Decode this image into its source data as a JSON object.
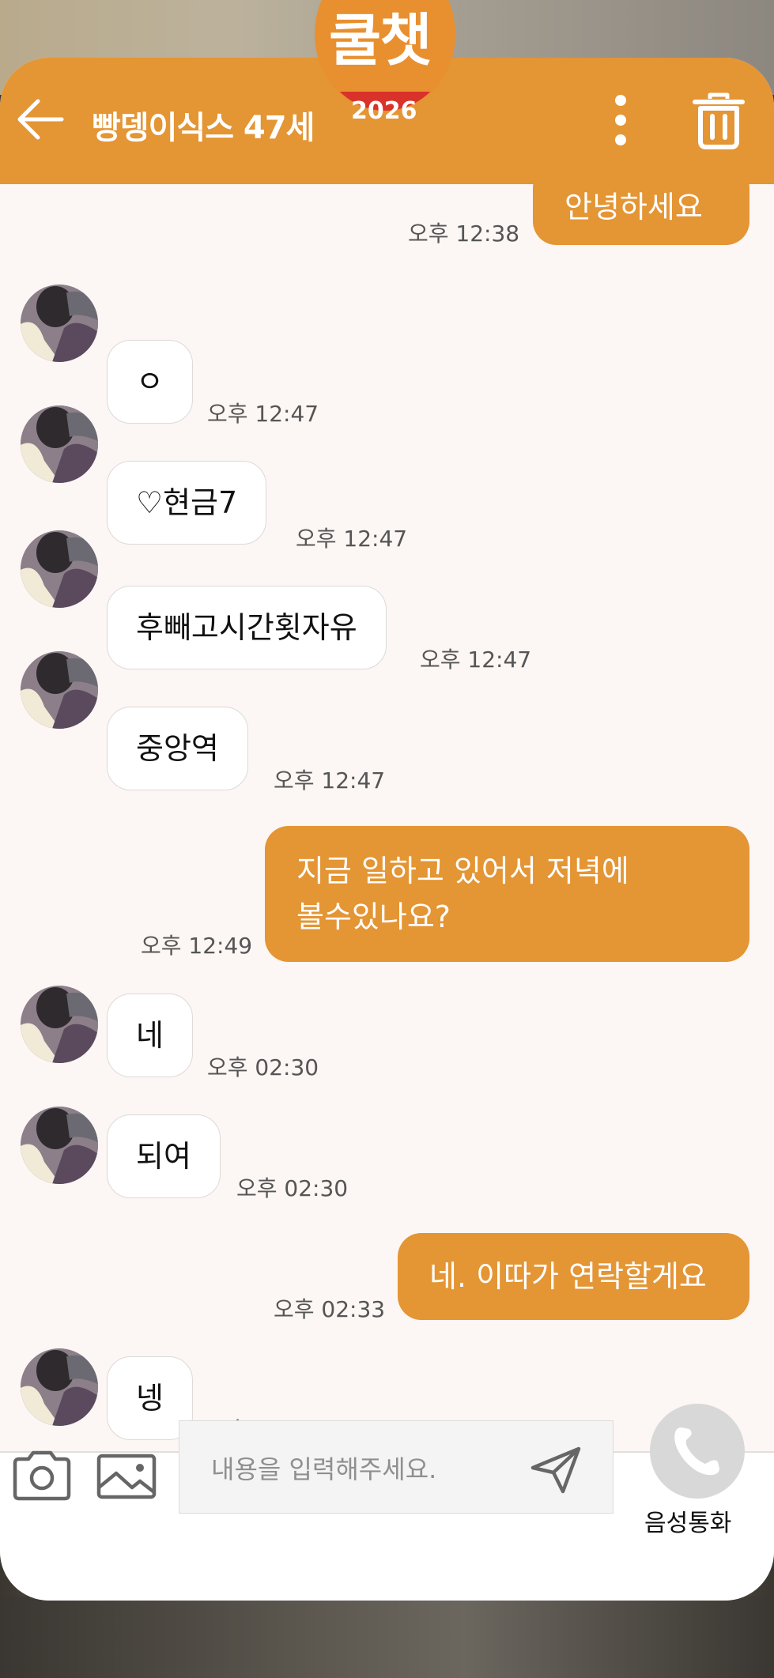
{
  "header": {
    "title": "빵뎅이식스 47세",
    "logo_text": "쿨챗",
    "logo_year": "2026"
  },
  "messages": [
    {
      "direction": "outgoing",
      "text": "안녕하세요",
      "time": "오후 12:38"
    },
    {
      "direction": "incoming",
      "text": "ㅇ",
      "time": "오후 12:47"
    },
    {
      "direction": "incoming",
      "text": "♡현금7",
      "time": "오후 12:47"
    },
    {
      "direction": "incoming",
      "text": "후빼고시간횟자유",
      "time": "오후 12:47"
    },
    {
      "direction": "incoming",
      "text": "중앙역",
      "time": "오후 12:47"
    },
    {
      "direction": "outgoing",
      "text_line1": "지금 일하고 있어서 저녁에",
      "text_line2": "볼수있나요?",
      "time": "오후 12:49"
    },
    {
      "direction": "incoming",
      "text": "네",
      "time": "오후 02:30"
    },
    {
      "direction": "incoming",
      "text": "되여",
      "time": "오후 02:30"
    },
    {
      "direction": "outgoing",
      "text": "네. 이따가 연락할게요",
      "time": "오후 02:33"
    },
    {
      "direction": "incoming",
      "text": "넹",
      "time": "오후 02:33"
    }
  ],
  "composer": {
    "placeholder": "내용을 입력해주세요.",
    "call_label": "음성통화"
  },
  "colors": {
    "accent": "#e49534",
    "background": "#fcf6f4",
    "incoming_bubble": "#ffffff",
    "logo_badge": "#d8322a"
  }
}
